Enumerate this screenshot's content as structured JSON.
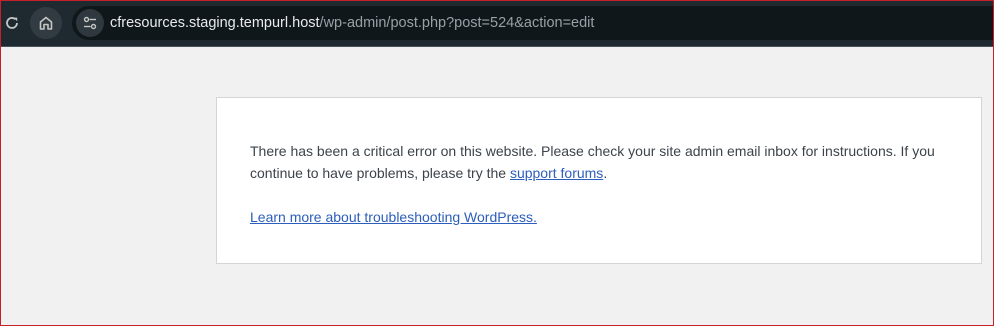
{
  "browser": {
    "url_host": "cfresources.staging.tempurl.host",
    "url_path": "/wp-admin/post.php?post=524&action=edit",
    "icons": [
      "reload-icon",
      "home-icon",
      "site-settings-icon"
    ]
  },
  "error": {
    "message_prefix": "There has been a critical error on this website. Please check your site admin email inbox for instructions. If you continue to have problems, please try the ",
    "support_link": "support forums",
    "message_suffix": ".",
    "learn_more_link": "Learn more about troubleshooting WordPress."
  },
  "colors": {
    "toolbar_bg": "#1f2a30",
    "page_bg": "#f1f1f1",
    "link": "#2c5ebb",
    "frame_border": "#c8202a"
  }
}
